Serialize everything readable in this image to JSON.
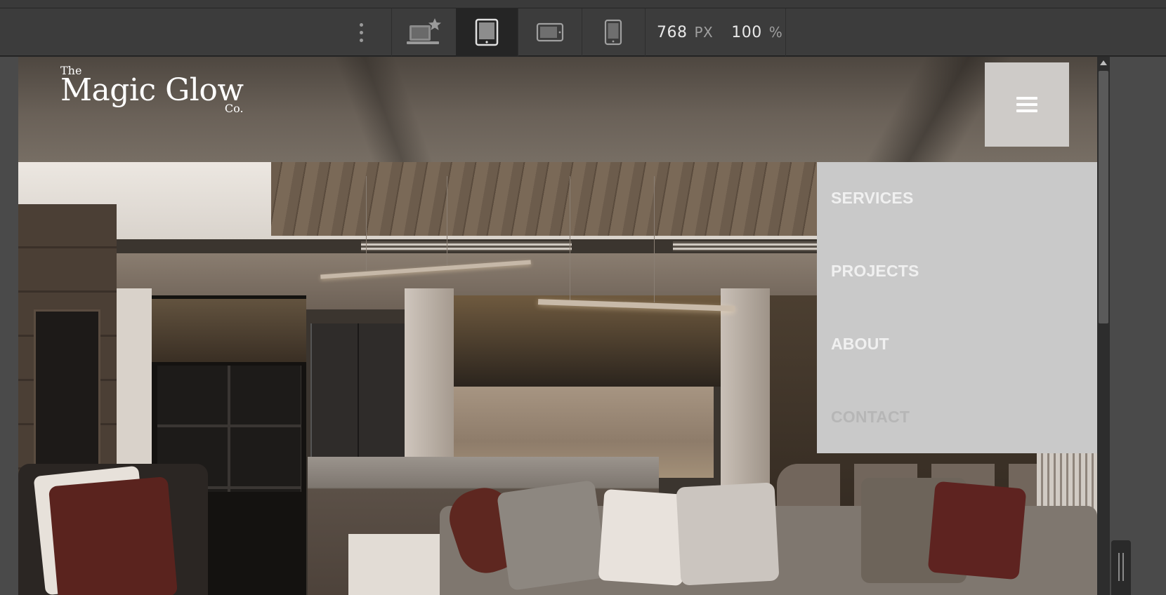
{
  "toolbar": {
    "more_icon": "kebab-vertical-icon",
    "devices": [
      {
        "name": "desktop-favorite",
        "icon": "laptop-star-icon",
        "active": false
      },
      {
        "name": "tablet-portrait",
        "icon": "tablet-portrait-icon",
        "active": true
      },
      {
        "name": "tablet-landscape",
        "icon": "tablet-landscape-icon",
        "active": false
      },
      {
        "name": "mobile-portrait",
        "icon": "mobile-portrait-icon",
        "active": false
      }
    ],
    "width_value": "768",
    "width_unit": "PX",
    "zoom_value": "100",
    "zoom_unit": "%"
  },
  "site": {
    "logo": {
      "line1": "The",
      "line2": "Magic Glow",
      "line3": "Co."
    },
    "menu_button_icon": "hamburger-icon",
    "nav": [
      "SERVICES",
      "PROJECTS",
      "ABOUT",
      "CONTACT"
    ],
    "colors": {
      "menu_panel": "#c9c9c9",
      "menu_button": "#cecbc8",
      "menu_text": "#f0f0f0",
      "toolbar": "#3c3c3c"
    }
  }
}
